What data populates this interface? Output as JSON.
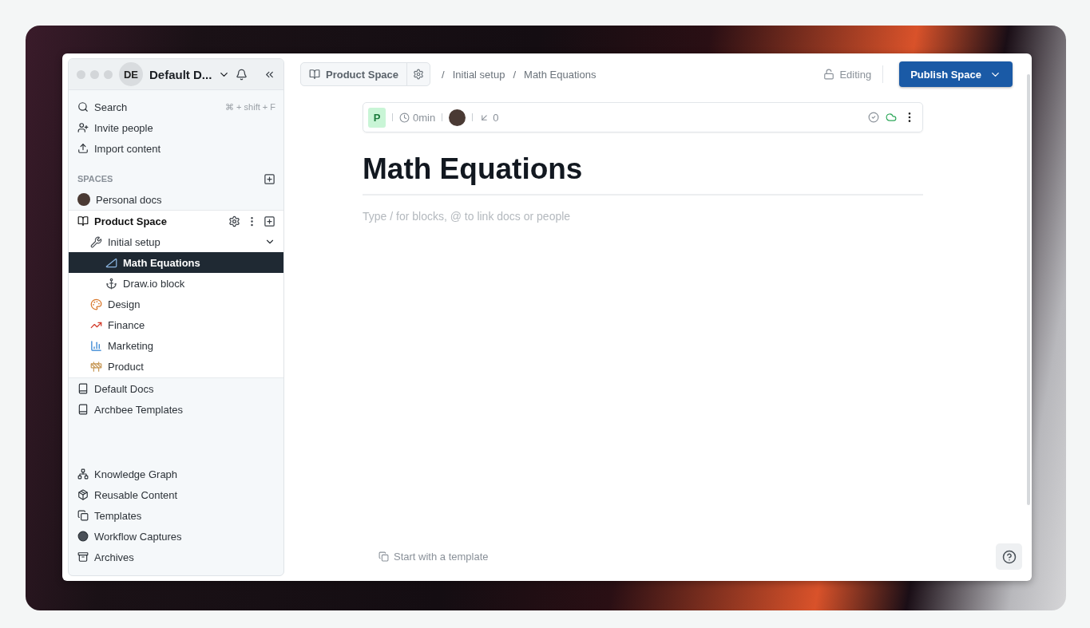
{
  "workspace": {
    "initials": "DE",
    "name": "Default D..."
  },
  "quick_actions": [
    {
      "label": "Search",
      "shortcut": "⌘ + shift + F"
    },
    {
      "label": "Invite people"
    },
    {
      "label": "Import content"
    }
  ],
  "spaces": {
    "heading": "SPACES",
    "personal": "Personal docs",
    "active_space": {
      "name": "Product Space",
      "children": [
        {
          "label": "Initial setup",
          "selected": false,
          "expanded": true,
          "children": [
            {
              "label": "Math Equations",
              "selected": true
            },
            {
              "label": "Draw.io block",
              "selected": false
            }
          ]
        },
        {
          "label": "Design",
          "selected": false
        },
        {
          "label": "Finance",
          "selected": false
        },
        {
          "label": "Marketing",
          "selected": false
        },
        {
          "label": "Product",
          "selected": false
        }
      ]
    },
    "other_spaces": [
      "Default Docs",
      "Archbee Templates"
    ]
  },
  "footer_links": [
    "Knowledge Graph",
    "Reusable Content",
    "Templates",
    "Workflow Captures",
    "Archives"
  ],
  "toolbar": {
    "space_button": "Product Space",
    "breadcrumbs": [
      {
        "separator": "/",
        "label": "Initial setup"
      },
      {
        "separator": "/",
        "label": "Math Equations"
      }
    ],
    "mode": "Editing",
    "publish": "Publish Space"
  },
  "doc": {
    "badge": "P",
    "read_time": "0min",
    "backlinks": "0",
    "title": "Math Equations",
    "placeholder": "Type / for blocks, @ to link docs or people",
    "template_link": "Start with a template"
  }
}
